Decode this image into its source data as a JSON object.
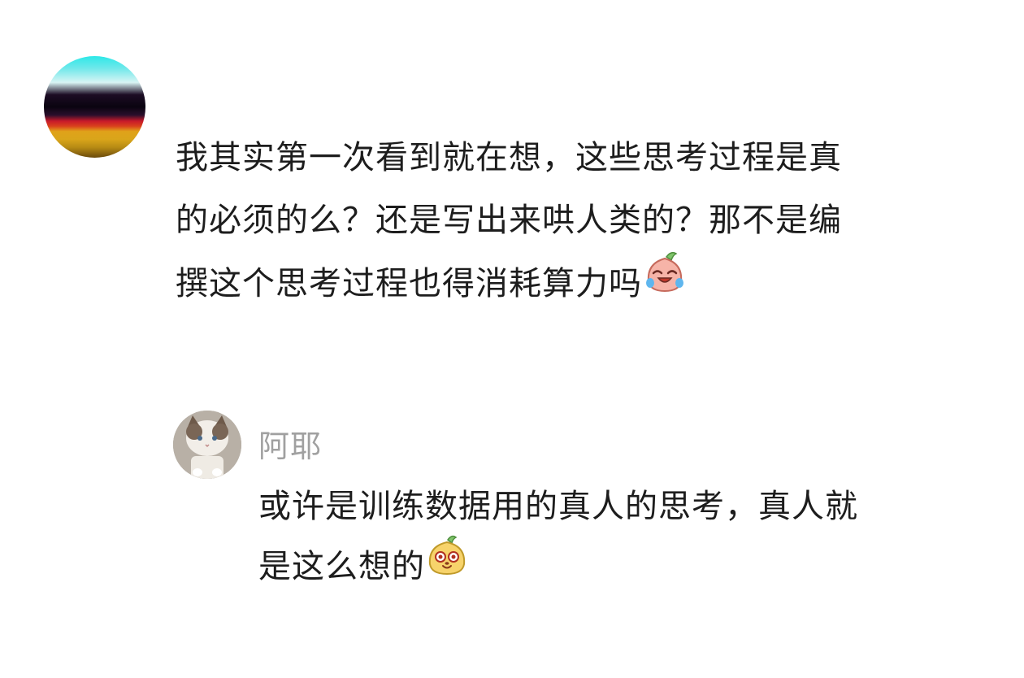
{
  "comment": {
    "avatar_icon": "gradient-avatar",
    "text_line1": "我其实第一次看到就在想，这些思考过程是真",
    "text_line2": "的必须的么？还是写出来哄人类的？那不是编",
    "text_line3": "撰这个思考过程也得消耗算力吗",
    "emoji_icon": "crying-laughing-emoji"
  },
  "reply": {
    "avatar_icon": "cat-avatar",
    "author": "阿耶",
    "text_line1": "或许是训练数据用的真人的思考，真人就",
    "text_line2": "是这么想的",
    "emoji_icon": "grinning-bun-emoji"
  }
}
